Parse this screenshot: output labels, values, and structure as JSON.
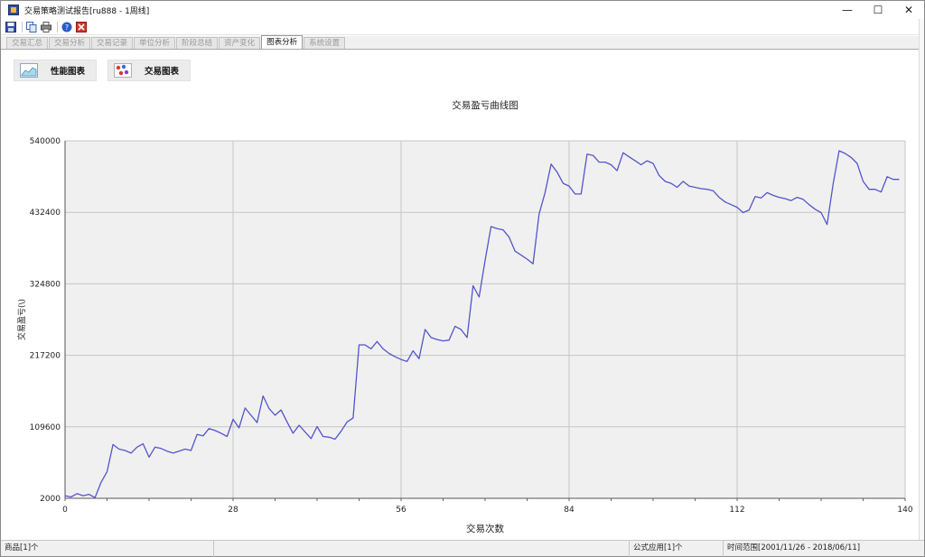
{
  "window": {
    "title": "交易策略测试报告[ru888 - 1周线]",
    "controls": {
      "minimize": "—",
      "maximize": "☐",
      "close": "✕"
    }
  },
  "toolbar": {
    "icons": [
      "save-icon",
      "copy-icon",
      "print-icon",
      "help-icon",
      "exit-icon"
    ]
  },
  "tabs": [
    {
      "label": "交易汇总",
      "active": false
    },
    {
      "label": "交易分析",
      "active": false
    },
    {
      "label": "交易记录",
      "active": false
    },
    {
      "label": "单位分析",
      "active": false
    },
    {
      "label": "阶段总结",
      "active": false
    },
    {
      "label": "资产变化",
      "active": false
    },
    {
      "label": "图表分析",
      "active": true
    },
    {
      "label": "系统设置",
      "active": false
    }
  ],
  "subbuttons": {
    "performance": "性能图表",
    "trade": "交易图表"
  },
  "statusbar": {
    "product": "商品[1]个",
    "formula": "公式应用[1]个",
    "time_range": "时间范围[2001/11/26 - 2018/06/11]"
  },
  "colors": {
    "line": "#5454cc",
    "plot_bg": "#f0f0f0",
    "grid": "#c6c6c6"
  },
  "chart_data": {
    "type": "line",
    "title": "交易盈亏曲线图",
    "xlabel": "交易次数",
    "ylabel": "交易盈亏(\\)",
    "xlim": [
      0,
      140
    ],
    "ylim": [
      2000,
      540000
    ],
    "x_ticks": [
      0,
      28,
      56,
      84,
      112,
      140
    ],
    "y_ticks": [
      2000,
      109600,
      217200,
      324800,
      432400,
      540000
    ],
    "x_tick_labels": [
      "0",
      "28",
      "56",
      "84",
      "112",
      "140"
    ],
    "y_tick_labels": [
      "2000",
      "109600",
      "217200",
      "324800",
      "432400",
      "540000"
    ],
    "grid": true,
    "series": [
      {
        "values": [
          [
            0,
            6000
          ],
          [
            1,
            4000
          ],
          [
            2,
            9000
          ],
          [
            3,
            6000
          ],
          [
            4,
            8000
          ],
          [
            5,
            3000
          ],
          [
            6,
            26000
          ],
          [
            7,
            42000
          ],
          [
            8,
            83000
          ],
          [
            9,
            76000
          ],
          [
            10,
            74000
          ],
          [
            11,
            70000
          ],
          [
            12,
            79000
          ],
          [
            13,
            84000
          ],
          [
            14,
            64000
          ],
          [
            15,
            79000
          ],
          [
            16,
            77000
          ],
          [
            17,
            73000
          ],
          [
            18,
            70000
          ],
          [
            19,
            73000
          ],
          [
            20,
            76000
          ],
          [
            21,
            74000
          ],
          [
            22,
            98000
          ],
          [
            23,
            96000
          ],
          [
            24,
            107000
          ],
          [
            25,
            104000
          ],
          [
            26,
            100000
          ],
          [
            27,
            95000
          ],
          [
            28,
            121000
          ],
          [
            29,
            108000
          ],
          [
            30,
            138000
          ],
          [
            31,
            127000
          ],
          [
            32,
            116000
          ],
          [
            33,
            156000
          ],
          [
            34,
            137000
          ],
          [
            35,
            127000
          ],
          [
            36,
            135000
          ],
          [
            37,
            117000
          ],
          [
            38,
            100000
          ],
          [
            39,
            112000
          ],
          [
            40,
            102000
          ],
          [
            41,
            92000
          ],
          [
            42,
            110000
          ],
          [
            43,
            95000
          ],
          [
            44,
            94000
          ],
          [
            45,
            91000
          ],
          [
            46,
            103000
          ],
          [
            47,
            117000
          ],
          [
            48,
            123000
          ],
          [
            49,
            233000
          ],
          [
            50,
            233000
          ],
          [
            51,
            227000
          ],
          [
            52,
            238000
          ],
          [
            53,
            227000
          ],
          [
            54,
            220000
          ],
          [
            55,
            215000
          ],
          [
            56,
            211000
          ],
          [
            57,
            208000
          ],
          [
            58,
            224000
          ],
          [
            59,
            212000
          ],
          [
            60,
            256000
          ],
          [
            61,
            244000
          ],
          [
            62,
            241000
          ],
          [
            63,
            239000
          ],
          [
            64,
            240000
          ],
          [
            65,
            261000
          ],
          [
            66,
            256000
          ],
          [
            67,
            244000
          ],
          [
            68,
            322000
          ],
          [
            69,
            305000
          ],
          [
            70,
            360000
          ],
          [
            71,
            411000
          ],
          [
            72,
            408000
          ],
          [
            73,
            406000
          ],
          [
            74,
            395000
          ],
          [
            75,
            374000
          ],
          [
            76,
            368000
          ],
          [
            77,
            362000
          ],
          [
            78,
            355000
          ],
          [
            79,
            430000
          ],
          [
            80,
            462000
          ],
          [
            81,
            505000
          ],
          [
            82,
            493000
          ],
          [
            83,
            476000
          ],
          [
            84,
            472000
          ],
          [
            85,
            460000
          ],
          [
            86,
            460000
          ],
          [
            87,
            520000
          ],
          [
            88,
            518000
          ],
          [
            89,
            508000
          ],
          [
            90,
            508000
          ],
          [
            91,
            504000
          ],
          [
            92,
            495000
          ],
          [
            93,
            522000
          ],
          [
            94,
            516000
          ],
          [
            95,
            510000
          ],
          [
            96,
            504000
          ],
          [
            97,
            510000
          ],
          [
            98,
            506000
          ],
          [
            99,
            488000
          ],
          [
            100,
            479000
          ],
          [
            101,
            476000
          ],
          [
            102,
            470000
          ],
          [
            103,
            479000
          ],
          [
            104,
            472000
          ],
          [
            105,
            470000
          ],
          [
            106,
            468000
          ],
          [
            107,
            467000
          ],
          [
            108,
            465000
          ],
          [
            109,
            455000
          ],
          [
            110,
            448000
          ],
          [
            111,
            444000
          ],
          [
            112,
            440000
          ],
          [
            113,
            432000
          ],
          [
            114,
            436000
          ],
          [
            115,
            456000
          ],
          [
            116,
            454000
          ],
          [
            117,
            462000
          ],
          [
            118,
            458000
          ],
          [
            119,
            455000
          ],
          [
            120,
            453000
          ],
          [
            121,
            450000
          ],
          [
            122,
            455000
          ],
          [
            123,
            452000
          ],
          [
            124,
            444000
          ],
          [
            125,
            437000
          ],
          [
            126,
            432000
          ],
          [
            127,
            414000
          ],
          [
            128,
            475000
          ],
          [
            129,
            525000
          ],
          [
            130,
            521000
          ],
          [
            131,
            515000
          ],
          [
            132,
            506000
          ],
          [
            133,
            479000
          ],
          [
            134,
            467000
          ],
          [
            135,
            467000
          ],
          [
            136,
            463000
          ],
          [
            137,
            486000
          ],
          [
            138,
            482000
          ],
          [
            139,
            482000
          ]
        ]
      }
    ]
  }
}
